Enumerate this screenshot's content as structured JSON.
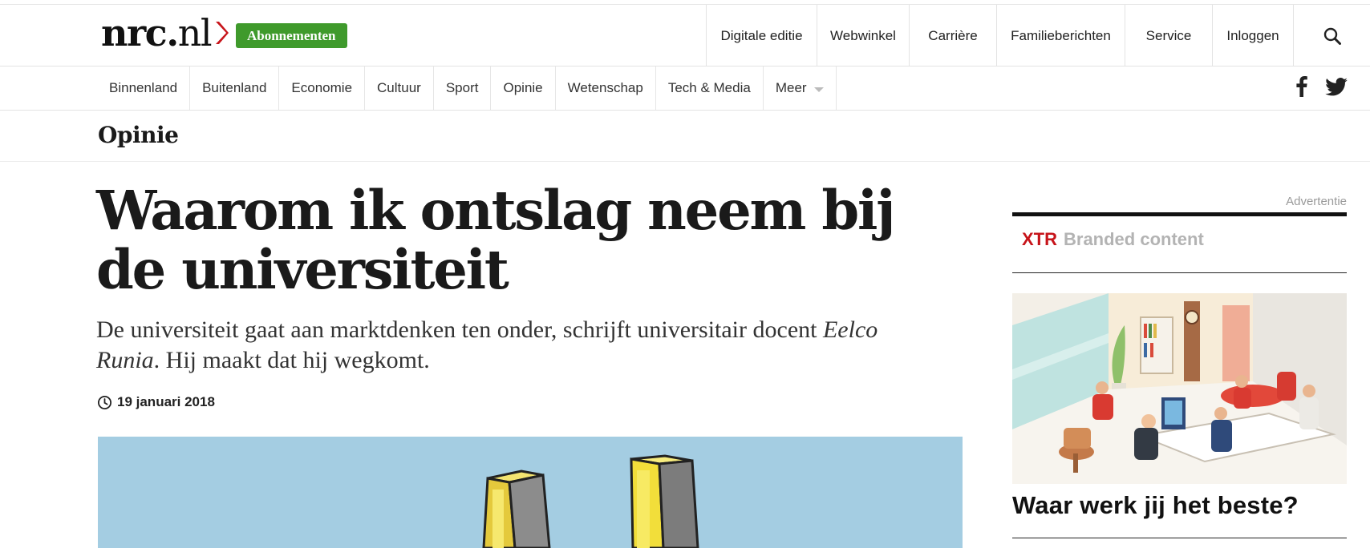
{
  "header": {
    "logo_main": "nrc.",
    "logo_suffix": "nl",
    "subscribe_label": "Abonnementen",
    "util_nav": [
      "Digitale editie",
      "Webwinkel",
      "Carrière",
      "Familieberichten",
      "Service",
      "Inloggen"
    ]
  },
  "sections": {
    "items": [
      "Binnenland",
      "Buitenland",
      "Economie",
      "Cultuur",
      "Sport",
      "Opinie",
      "Wetenschap",
      "Tech & Media"
    ],
    "more_label": "Meer"
  },
  "section_title": "Opinie",
  "article": {
    "headline": "Waarom ik ontslag neem bij de universiteit",
    "intro_prefix": "De universiteit gaat aan marktdenken ten onder, schrijft universitair docent ",
    "intro_author": "Eelco Runia",
    "intro_suffix": ". Hij maakt dat hij wegkomt.",
    "date": "19 januari 2018"
  },
  "sidebar": {
    "ad_label": "Advertentie",
    "brand_xtr": "XTR",
    "brand_label": "Branded content",
    "ad_headline": "Waar werk jij het beste?"
  },
  "colors": {
    "subscribe_green": "#3f9a2c",
    "logo_red": "#c7141a",
    "hero_sky": "#a4cde2",
    "xtr_red": "#c7141a"
  },
  "icons": [
    "search-icon",
    "facebook-icon",
    "twitter-icon",
    "clock-icon",
    "chevron-down-icon"
  ]
}
